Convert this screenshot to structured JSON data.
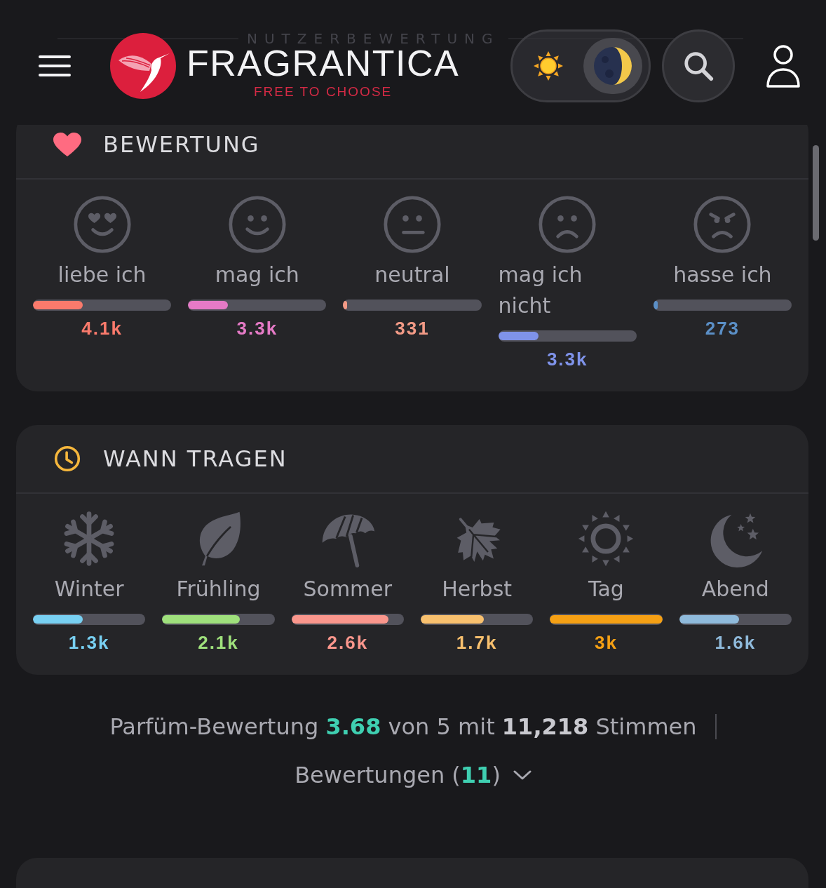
{
  "header": {
    "background_heading": "NUTZERBEWERTUNG",
    "logo": {
      "name": "FRAGRANTICA",
      "tagline": "FREE TO CHOOSE"
    },
    "theme_toggle": [
      {
        "kind": "light",
        "selected": false
      },
      {
        "kind": "dark",
        "selected": true
      }
    ]
  },
  "rating_card": {
    "title": "BEWERTUNG",
    "items": [
      {
        "kind": "love",
        "label": "liebe ich",
        "level": 0.36,
        "value": "4.1k",
        "color": "#fa7a6c"
      },
      {
        "kind": "like",
        "label": "mag ich",
        "level": 0.29,
        "value": "3.3k",
        "color": "#e57ac6"
      },
      {
        "kind": "neutral",
        "label": "neutral",
        "level": 0.03,
        "value": "331",
        "color": "#f29a86"
      },
      {
        "kind": "dislike",
        "label": "mag ich nicht",
        "level": 0.29,
        "value": "3.3k",
        "color": "#7f93ea"
      },
      {
        "kind": "hate",
        "label": "hasse ich",
        "level": 0.03,
        "value": "273",
        "color": "#5b8fc6"
      }
    ]
  },
  "wear_card": {
    "title": "WANN TRAGEN",
    "items": [
      {
        "kind": "winter",
        "label": "Winter",
        "level": 0.44,
        "value": "1.3k",
        "color": "#78d0f2"
      },
      {
        "kind": "spring",
        "label": "Frühling",
        "level": 0.69,
        "value": "2.1k",
        "color": "#9fe07c"
      },
      {
        "kind": "summer",
        "label": "Sommer",
        "level": 0.86,
        "value": "2.6k",
        "color": "#fa968c"
      },
      {
        "kind": "autumn",
        "label": "Herbst",
        "level": 0.56,
        "value": "1.7k",
        "color": "#f8c06e"
      },
      {
        "kind": "day",
        "label": "Tag",
        "level": 1,
        "value": "3k",
        "color": "#f5a014"
      },
      {
        "kind": "night",
        "label": "Abend",
        "level": 0.53,
        "value": "1.6k",
        "color": "#8fbadb"
      }
    ]
  },
  "summary": {
    "text": "Parfüm-Bewertung **3.68** von 5 mit **11,218** Stimmen",
    "reviews": {
      "label": "Bewertungen (**11**)",
      "expanded": false
    }
  }
}
